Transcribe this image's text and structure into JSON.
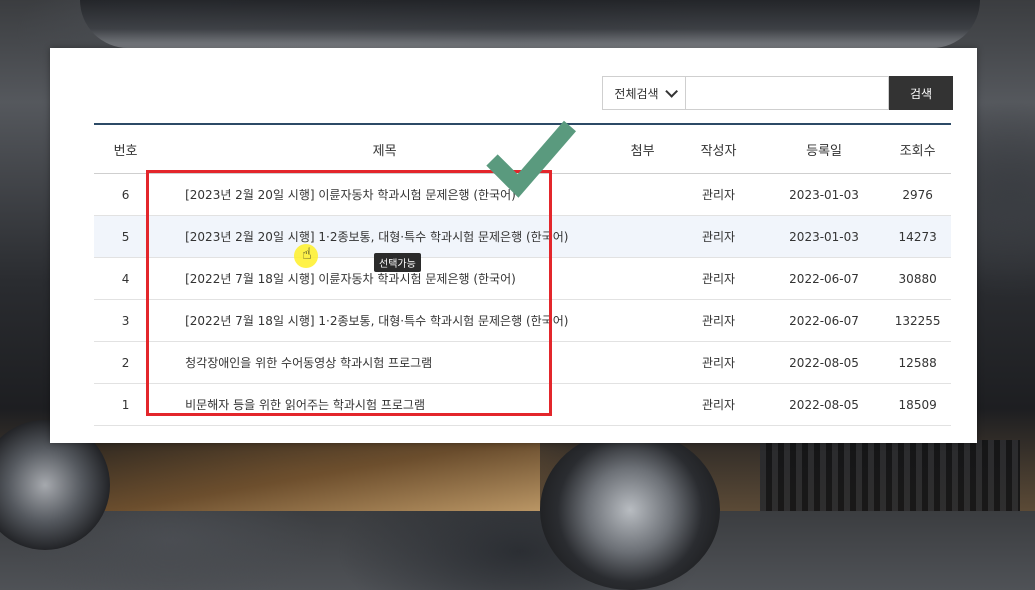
{
  "search": {
    "scope_label": "전체검색",
    "input_value": "",
    "button_label": "검색"
  },
  "table": {
    "headers": {
      "no": "번호",
      "title": "제목",
      "attachment": "첨부",
      "author": "작성자",
      "date": "등록일",
      "views": "조회수"
    },
    "rows": [
      {
        "no": "6",
        "title": "[2023년 2월 20일 시행] 이륜자동차 학과시험 문제은행 (한국어)",
        "author": "관리자",
        "date": "2023-01-03",
        "views": "2976"
      },
      {
        "no": "5",
        "title": "[2023년 2월 20일 시행] 1·2종보통, 대형·특수 학과시험 문제은행 (한국어)",
        "author": "관리자",
        "date": "2023-01-03",
        "views": "14273"
      },
      {
        "no": "4",
        "title": "[2022년 7월 18일 시행] 이륜자동차 학과시험 문제은행 (한국어)",
        "author": "관리자",
        "date": "2022-06-07",
        "views": "30880"
      },
      {
        "no": "3",
        "title": "[2022년 7월 18일 시행] 1·2종보통, 대형·특수 학과시험 문제은행 (한국어)",
        "author": "관리자",
        "date": "2022-06-07",
        "views": "132255"
      },
      {
        "no": "2",
        "title": "청각장애인을 위한 수어동영상 학과시험 프로그램",
        "author": "관리자",
        "date": "2022-08-05",
        "views": "12588"
      },
      {
        "no": "1",
        "title": "비문해자 등을 위한 읽어주는 학과시험 프로그램",
        "author": "관리자",
        "date": "2022-08-05",
        "views": "18509"
      }
    ]
  },
  "tooltip": "선택가능",
  "colors": {
    "header_border": "#2c4a66",
    "highlight_box": "#e3262b",
    "checkmark": "#5a9a7e",
    "search_button": "#333333"
  }
}
